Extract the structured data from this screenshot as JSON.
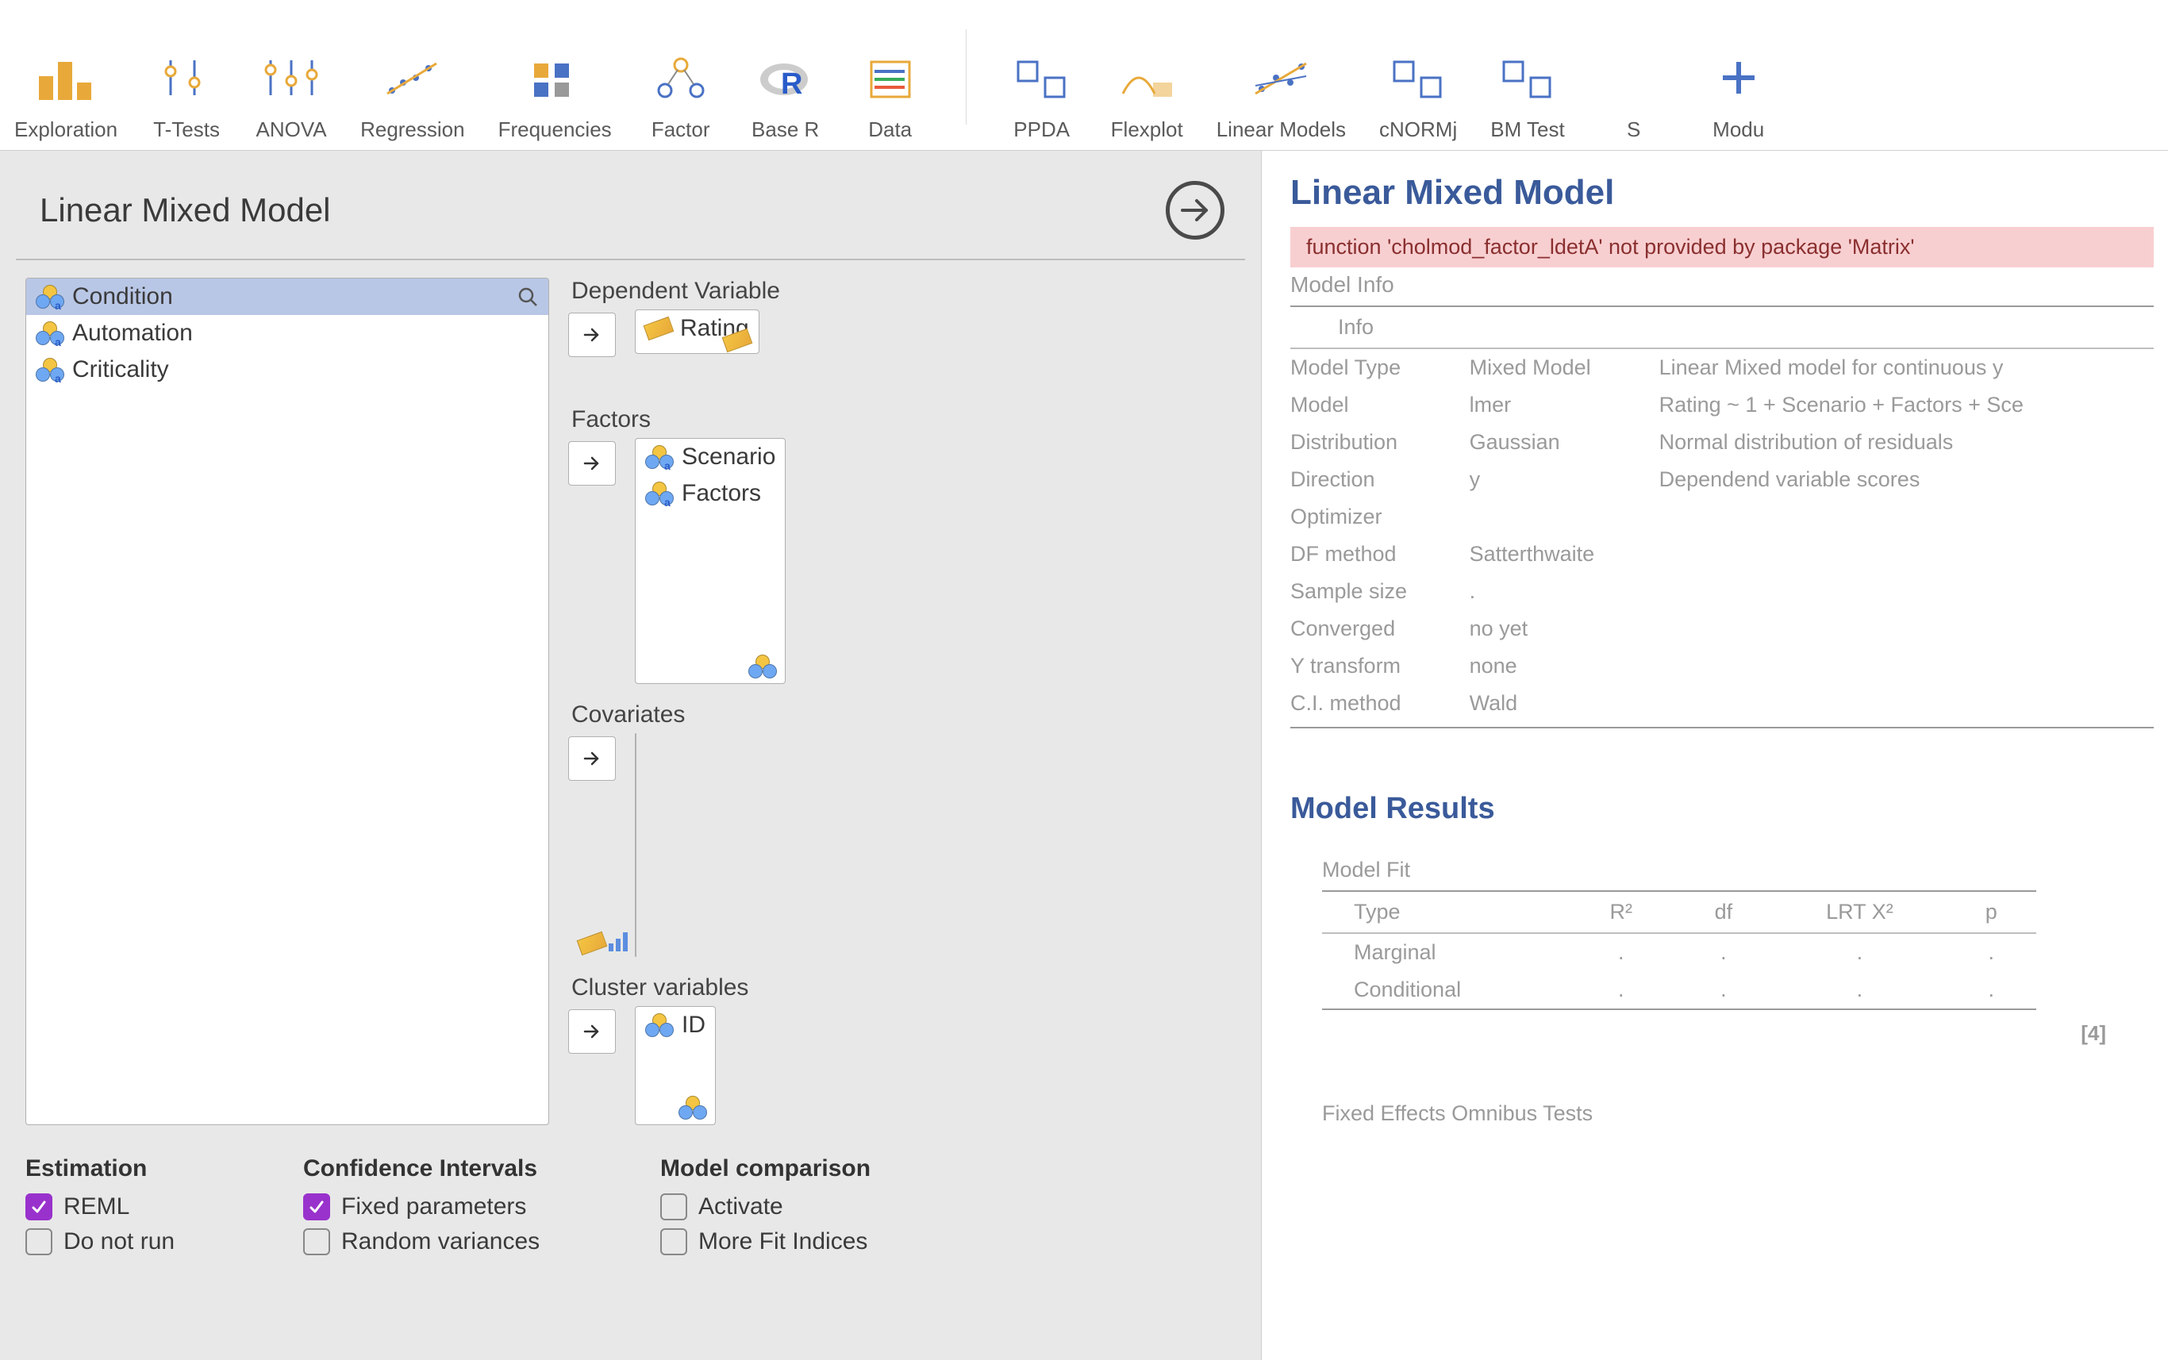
{
  "toolbar": [
    {
      "label": "Exploration"
    },
    {
      "label": "T-Tests"
    },
    {
      "label": "ANOVA"
    },
    {
      "label": "Regression"
    },
    {
      "label": "Frequencies"
    },
    {
      "label": "Factor"
    },
    {
      "label": "Base R"
    },
    {
      "label": "Data"
    },
    {
      "label": "PPDA"
    },
    {
      "label": "Flexplot"
    },
    {
      "label": "Linear Models"
    },
    {
      "label": "cNORMj"
    },
    {
      "label": "BM Test"
    },
    {
      "label": "S"
    },
    {
      "label": "Modu"
    }
  ],
  "panel": {
    "title": "Linear Mixed Model"
  },
  "source_vars": [
    {
      "name": "Condition",
      "selected": true
    },
    {
      "name": "Automation",
      "selected": false
    },
    {
      "name": "Criticality",
      "selected": false
    }
  ],
  "targets": {
    "dependent": {
      "label": "Dependent Variable",
      "items": [
        "Rating"
      ]
    },
    "factors": {
      "label": "Factors",
      "items": [
        "Scenario",
        "Factors"
      ]
    },
    "covariates": {
      "label": "Covariates",
      "items": []
    },
    "cluster": {
      "label": "Cluster variables",
      "items": [
        "ID"
      ]
    }
  },
  "options": {
    "estimation": {
      "title": "Estimation",
      "reml": {
        "label": "REML",
        "checked": true
      },
      "donotrun": {
        "label": "Do not run",
        "checked": false
      }
    },
    "ci": {
      "title": "Confidence Intervals",
      "fixed": {
        "label": "Fixed parameters",
        "checked": true
      },
      "random": {
        "label": "Random variances",
        "checked": false
      }
    },
    "compare": {
      "title": "Model comparison",
      "activate": {
        "label": "Activate",
        "checked": false
      },
      "morefit": {
        "label": "More Fit Indices",
        "checked": false
      }
    }
  },
  "results": {
    "title": "Linear Mixed Model",
    "error": "function 'cholmod_factor_ldetA' not provided by package 'Matrix'",
    "model_info_label": "Model Info",
    "info_header": "Info",
    "info_rows": [
      {
        "k": "Model Type",
        "v1": "Mixed Model",
        "v2": "Linear Mixed model for continuous y"
      },
      {
        "k": "Model",
        "v1": "lmer",
        "v2": "Rating ~ 1 + Scenario + Factors + Sce"
      },
      {
        "k": "Distribution",
        "v1": "Gaussian",
        "v2": "Normal distribution of residuals"
      },
      {
        "k": "Direction",
        "v1": "y",
        "v2": "Dependend variable scores"
      },
      {
        "k": "Optimizer",
        "v1": "",
        "v2": ""
      },
      {
        "k": "DF method",
        "v1": "Satterthwaite",
        "v2": ""
      },
      {
        "k": "Sample size",
        "v1": ".",
        "v2": ""
      },
      {
        "k": "Converged",
        "v1": "no yet",
        "v2": ""
      },
      {
        "k": "Y transform",
        "v1": "none",
        "v2": ""
      },
      {
        "k": "C.I. method",
        "v1": "Wald",
        "v2": ""
      }
    ],
    "results_header": "Model Results",
    "fit_caption": "Model Fit",
    "fit_headers": [
      "Type",
      "R²",
      "df",
      "LRT X²",
      "p"
    ],
    "fit_rows": [
      {
        "type": "Marginal",
        "r2": ".",
        "df": ".",
        "lrt": ".",
        "p": "."
      },
      {
        "type": "Conditional",
        "r2": ".",
        "df": ".",
        "lrt": ".",
        "p": "."
      }
    ],
    "note": "[4]",
    "omnibus": "Fixed Effects Omnibus Tests"
  }
}
